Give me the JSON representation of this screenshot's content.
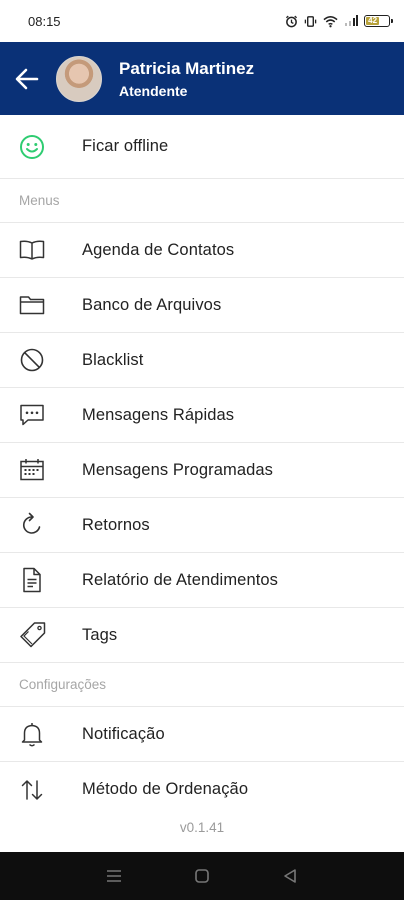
{
  "status_bar": {
    "time": "08:15",
    "battery": "42"
  },
  "header": {
    "name": "Patricia Martinez",
    "role": "Atendente"
  },
  "menu": {
    "status_item": "Ficar offline",
    "section_menus": "Menus",
    "items": [
      {
        "label": "Agenda de Contatos",
        "icon": "book-icon"
      },
      {
        "label": "Banco de Arquivos",
        "icon": "folder-icon"
      },
      {
        "label": "Blacklist",
        "icon": "block-icon"
      },
      {
        "label": "Mensagens Rápidas",
        "icon": "chat-dots-icon"
      },
      {
        "label": "Mensagens Programadas",
        "icon": "calendar-icon"
      },
      {
        "label": "Retornos",
        "icon": "refresh-icon"
      },
      {
        "label": "Relatório de Atendimentos",
        "icon": "document-icon"
      },
      {
        "label": "Tags",
        "icon": "tag-icon"
      }
    ],
    "section_config": "Configurações",
    "config_items": [
      {
        "label": "Notificação",
        "icon": "bell-icon"
      },
      {
        "label": "Método de Ordenação",
        "icon": "sort-icon"
      }
    ]
  },
  "version": "v0.1.41",
  "colors": {
    "header_bg": "#0a3177",
    "online_green": "#2ecc71"
  }
}
